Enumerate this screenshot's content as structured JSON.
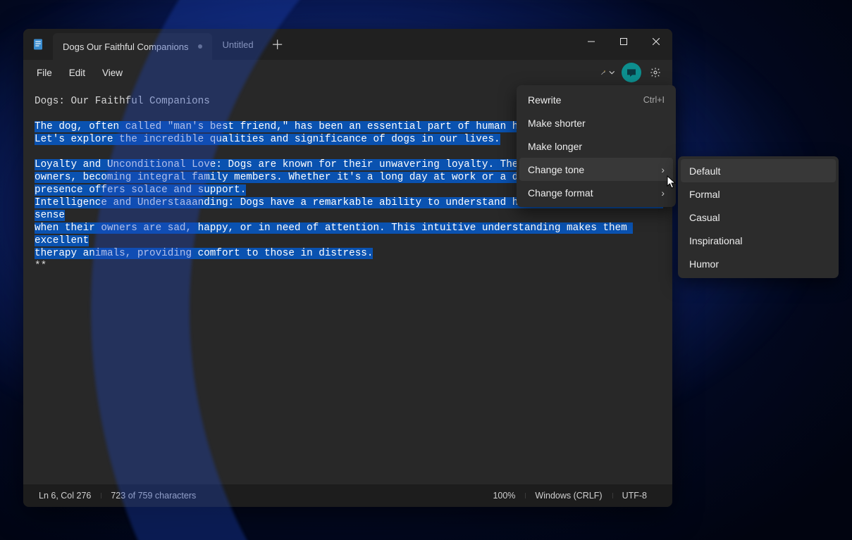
{
  "window": {
    "app_name": "Notepad",
    "tabs": [
      {
        "title": "Dogs Our Faithful Companions",
        "active": true,
        "dirty": true
      },
      {
        "title": "Untitled",
        "active": false,
        "dirty": false
      }
    ]
  },
  "menubar": {
    "file": "File",
    "edit": "Edit",
    "view": "View"
  },
  "editor": {
    "title_line": "Dogs: Our Faithful Companions",
    "p1a": "The dog, often called \"man's best friend,\" has been an essential part of human history",
    "p1b": "Let's explore the incredible qualities and significance of dogs in our lives.",
    "p2a": "Loyalty and Unconditional Love: Dogs are known for their unwavering loyalty. They form",
    "p2b": "owners, becoming integral family members. Whether it's a long day at work or a difficu",
    "p2c": "presence offers solace and support.",
    "p3a": "Intelligence and Understaaanding: Dogs have a remarkable ability to understand human emotions. They can sense",
    "p3b": "when their owners are sad, happy, or in need of attention. This intuitive understanding makes them excellent",
    "p3c": "therapy animals, providing comfort to those in distress.",
    "trail": "**"
  },
  "context_menu": {
    "items": [
      {
        "label": "Rewrite",
        "shortcut": "Ctrl+I"
      },
      {
        "label": "Make shorter"
      },
      {
        "label": "Make longer"
      },
      {
        "label": "Change tone",
        "submenu": true,
        "hover": true
      },
      {
        "label": "Change format",
        "submenu": true
      }
    ]
  },
  "tone_submenu": {
    "items": [
      {
        "label": "Default",
        "hover": true
      },
      {
        "label": "Formal"
      },
      {
        "label": "Casual"
      },
      {
        "label": "Inspirational"
      },
      {
        "label": "Humor"
      }
    ]
  },
  "statusbar": {
    "position": "Ln 6, Col 276",
    "chars": "723 of 759 characters",
    "zoom": "100%",
    "eol": "Windows (CRLF)",
    "encoding": "UTF-8"
  }
}
